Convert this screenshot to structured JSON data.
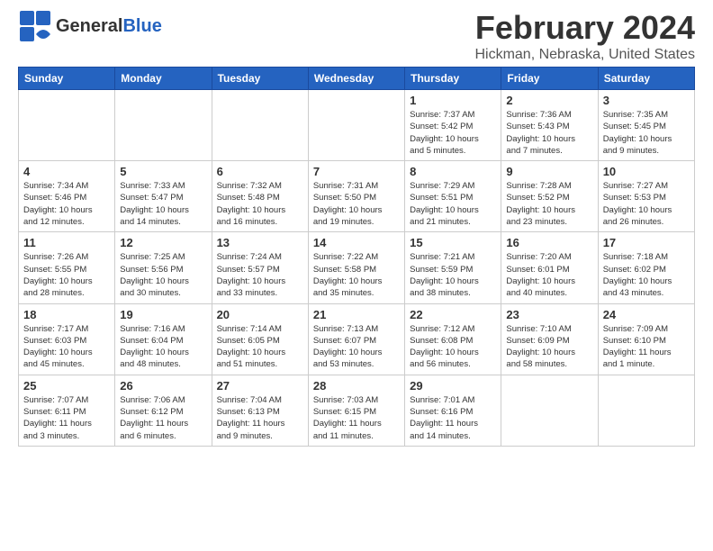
{
  "header": {
    "logo_general": "General",
    "logo_blue": "Blue",
    "main_title": "February 2024",
    "subtitle": "Hickman, Nebraska, United States"
  },
  "days_of_week": [
    "Sunday",
    "Monday",
    "Tuesday",
    "Wednesday",
    "Thursday",
    "Friday",
    "Saturday"
  ],
  "weeks": [
    [
      {
        "day": "",
        "info": ""
      },
      {
        "day": "",
        "info": ""
      },
      {
        "day": "",
        "info": ""
      },
      {
        "day": "",
        "info": ""
      },
      {
        "day": "1",
        "info": "Sunrise: 7:37 AM\nSunset: 5:42 PM\nDaylight: 10 hours\nand 5 minutes."
      },
      {
        "day": "2",
        "info": "Sunrise: 7:36 AM\nSunset: 5:43 PM\nDaylight: 10 hours\nand 7 minutes."
      },
      {
        "day": "3",
        "info": "Sunrise: 7:35 AM\nSunset: 5:45 PM\nDaylight: 10 hours\nand 9 minutes."
      }
    ],
    [
      {
        "day": "4",
        "info": "Sunrise: 7:34 AM\nSunset: 5:46 PM\nDaylight: 10 hours\nand 12 minutes."
      },
      {
        "day": "5",
        "info": "Sunrise: 7:33 AM\nSunset: 5:47 PM\nDaylight: 10 hours\nand 14 minutes."
      },
      {
        "day": "6",
        "info": "Sunrise: 7:32 AM\nSunset: 5:48 PM\nDaylight: 10 hours\nand 16 minutes."
      },
      {
        "day": "7",
        "info": "Sunrise: 7:31 AM\nSunset: 5:50 PM\nDaylight: 10 hours\nand 19 minutes."
      },
      {
        "day": "8",
        "info": "Sunrise: 7:29 AM\nSunset: 5:51 PM\nDaylight: 10 hours\nand 21 minutes."
      },
      {
        "day": "9",
        "info": "Sunrise: 7:28 AM\nSunset: 5:52 PM\nDaylight: 10 hours\nand 23 minutes."
      },
      {
        "day": "10",
        "info": "Sunrise: 7:27 AM\nSunset: 5:53 PM\nDaylight: 10 hours\nand 26 minutes."
      }
    ],
    [
      {
        "day": "11",
        "info": "Sunrise: 7:26 AM\nSunset: 5:55 PM\nDaylight: 10 hours\nand 28 minutes."
      },
      {
        "day": "12",
        "info": "Sunrise: 7:25 AM\nSunset: 5:56 PM\nDaylight: 10 hours\nand 30 minutes."
      },
      {
        "day": "13",
        "info": "Sunrise: 7:24 AM\nSunset: 5:57 PM\nDaylight: 10 hours\nand 33 minutes."
      },
      {
        "day": "14",
        "info": "Sunrise: 7:22 AM\nSunset: 5:58 PM\nDaylight: 10 hours\nand 35 minutes."
      },
      {
        "day": "15",
        "info": "Sunrise: 7:21 AM\nSunset: 5:59 PM\nDaylight: 10 hours\nand 38 minutes."
      },
      {
        "day": "16",
        "info": "Sunrise: 7:20 AM\nSunset: 6:01 PM\nDaylight: 10 hours\nand 40 minutes."
      },
      {
        "day": "17",
        "info": "Sunrise: 7:18 AM\nSunset: 6:02 PM\nDaylight: 10 hours\nand 43 minutes."
      }
    ],
    [
      {
        "day": "18",
        "info": "Sunrise: 7:17 AM\nSunset: 6:03 PM\nDaylight: 10 hours\nand 45 minutes."
      },
      {
        "day": "19",
        "info": "Sunrise: 7:16 AM\nSunset: 6:04 PM\nDaylight: 10 hours\nand 48 minutes."
      },
      {
        "day": "20",
        "info": "Sunrise: 7:14 AM\nSunset: 6:05 PM\nDaylight: 10 hours\nand 51 minutes."
      },
      {
        "day": "21",
        "info": "Sunrise: 7:13 AM\nSunset: 6:07 PM\nDaylight: 10 hours\nand 53 minutes."
      },
      {
        "day": "22",
        "info": "Sunrise: 7:12 AM\nSunset: 6:08 PM\nDaylight: 10 hours\nand 56 minutes."
      },
      {
        "day": "23",
        "info": "Sunrise: 7:10 AM\nSunset: 6:09 PM\nDaylight: 10 hours\nand 58 minutes."
      },
      {
        "day": "24",
        "info": "Sunrise: 7:09 AM\nSunset: 6:10 PM\nDaylight: 11 hours\nand 1 minute."
      }
    ],
    [
      {
        "day": "25",
        "info": "Sunrise: 7:07 AM\nSunset: 6:11 PM\nDaylight: 11 hours\nand 3 minutes."
      },
      {
        "day": "26",
        "info": "Sunrise: 7:06 AM\nSunset: 6:12 PM\nDaylight: 11 hours\nand 6 minutes."
      },
      {
        "day": "27",
        "info": "Sunrise: 7:04 AM\nSunset: 6:13 PM\nDaylight: 11 hours\nand 9 minutes."
      },
      {
        "day": "28",
        "info": "Sunrise: 7:03 AM\nSunset: 6:15 PM\nDaylight: 11 hours\nand 11 minutes."
      },
      {
        "day": "29",
        "info": "Sunrise: 7:01 AM\nSunset: 6:16 PM\nDaylight: 11 hours\nand 14 minutes."
      },
      {
        "day": "",
        "info": ""
      },
      {
        "day": "",
        "info": ""
      }
    ]
  ]
}
